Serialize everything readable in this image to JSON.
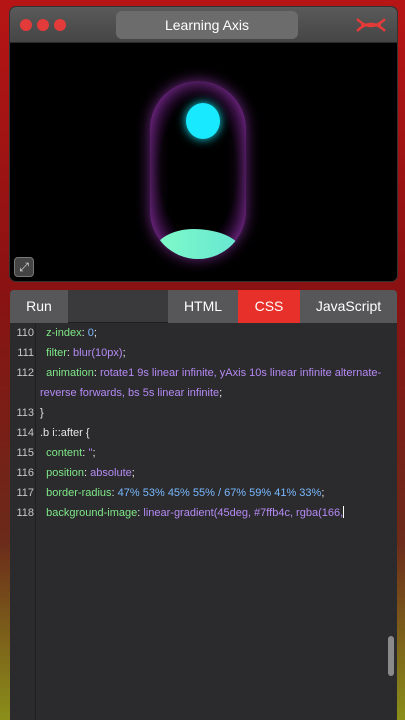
{
  "window": {
    "title": "Learning Axis",
    "accent": "#e33a3a"
  },
  "preview": {
    "capsule_glow": "#a648c8",
    "top_blob_color": "#19e9ff",
    "bottom_blob_color": "#7ffbc8",
    "fullscreen_icon": "fullscreen-icon"
  },
  "editor": {
    "run_label": "Run",
    "tabs": [
      {
        "label": "HTML",
        "active": false
      },
      {
        "label": "CSS",
        "active": true
      },
      {
        "label": "JavaScript",
        "active": false
      }
    ],
    "active_color": "#e8302a",
    "lines": [
      {
        "n": "110",
        "prop": "z-index",
        "value": "0",
        "raw": ""
      },
      {
        "n": "111",
        "prop": "filter",
        "value": "blur(10px)",
        "raw": ""
      },
      {
        "n": "112",
        "prop": "animation",
        "value": "rotate1 9s linear infinite, yAxis 10s linear infinite alternate-reverse forwards, bs 5s linear infinite",
        "raw": ""
      },
      {
        "n": "113",
        "prop": "",
        "value": "",
        "raw": "}"
      },
      {
        "n": "114",
        "prop": "",
        "value": "",
        "raw": ".b i::after {"
      },
      {
        "n": "115",
        "prop": "content",
        "value": "''",
        "raw": ""
      },
      {
        "n": "116",
        "prop": "position",
        "value": "absolute",
        "raw": ""
      },
      {
        "n": "117",
        "prop": "border-radius",
        "value": "47% 53% 45% 55% / 67% 59% 41% 33%",
        "raw": ""
      },
      {
        "n": "118",
        "prop": "background-image",
        "value": "linear-gradient(45deg, #7ffb4c, rgba(166,",
        "raw": ""
      }
    ]
  }
}
